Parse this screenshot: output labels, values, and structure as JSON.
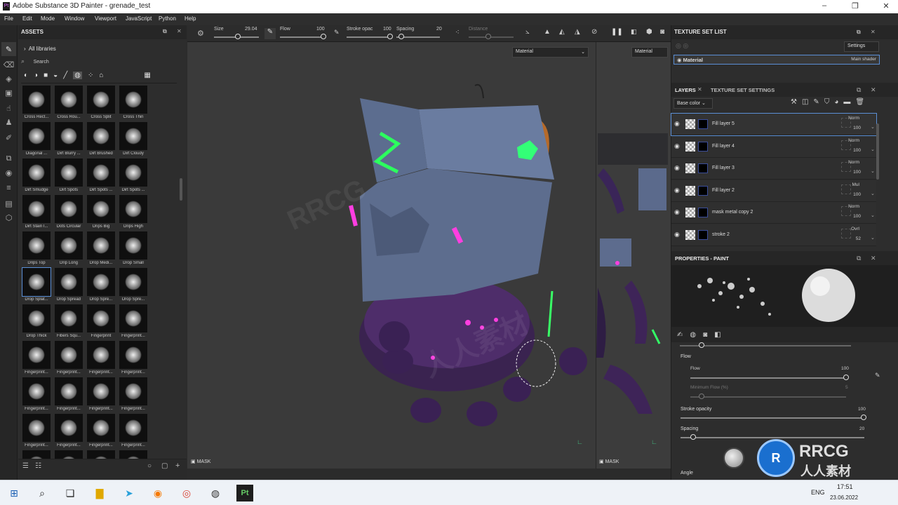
{
  "window": {
    "title": "Adobe Substance 3D Painter - grenade_test"
  },
  "menu": [
    "File",
    "Edit",
    "Mode",
    "Window",
    "Viewport",
    "JavaScript",
    "Python",
    "Help"
  ],
  "assets": {
    "title": "ASSETS",
    "breadcrumb": "All libraries",
    "search_placeholder": "Search",
    "items": [
      "Cross Rect...",
      "Cross Rou...",
      "Cross Split",
      "Cross Thin",
      "Diagonal ...",
      "Dirt Blurry ...",
      "Dirt Brushed",
      "Dirt Cloudy",
      "Dirt Smudge",
      "Dirt Spots",
      "Dirt Spots ...",
      "Dirt Spots ...",
      "Dirt Stain I...",
      "Dots Circular",
      "Drips Big",
      "Drips High",
      "Drips Top",
      "Drip Long",
      "Drop Medi...",
      "Drop Small",
      "Drop Splat...",
      "Drop Spread",
      "Drop Spre...",
      "Drop Spre...",
      "Drop Thick",
      "Fibers Squ...",
      "Fingerprint",
      "Fingerprint...",
      "Fingerprint...",
      "Fingerprint...",
      "Fingerprint...",
      "Fingerprint...",
      "Fingerprint...",
      "Fingerprint...",
      "Fingerprint...",
      "Fingerprint...",
      "Fingerprint...",
      "Fingerprint...",
      "Fingerprint...",
      "Fingerprint...",
      "",
      "",
      "",
      ""
    ],
    "selected_index": 20
  },
  "toolbar": {
    "size_label": "Size",
    "size_value": "29.04",
    "flow_label": "Flow",
    "flow_value": "100",
    "stroke_label": "Stroke opac",
    "stroke_value": "100",
    "spacing_label": "Spacing",
    "spacing_value": "20",
    "distance_label": "Distance"
  },
  "viewport": {
    "material_dropdown": "Material",
    "uv_material": "Material",
    "mask_label": "MASK",
    "uv_mask_label": "MASK"
  },
  "texture_set_list": {
    "title": "TEXTURE SET LIST",
    "settings": "Settings",
    "item": "Material",
    "shader": "Main shader"
  },
  "layers": {
    "tab1": "LAYERS",
    "tab2": "TEXTURE SET SETTINGS",
    "channel": "Base color",
    "rows": [
      {
        "name": "Fill layer 5",
        "blend": "Norm",
        "opacity": "100"
      },
      {
        "name": "Fill layer 4",
        "blend": "Norm",
        "opacity": "100"
      },
      {
        "name": "Fill layer 3",
        "blend": "Norm",
        "opacity": "100"
      },
      {
        "name": "Fill layer 2",
        "blend": "Mul",
        "opacity": "100"
      },
      {
        "name": "mask metal copy 2",
        "blend": "Norm",
        "opacity": "100"
      },
      {
        "name": "stroke 2",
        "blend": "Ovrl",
        "opacity": "52"
      }
    ]
  },
  "properties": {
    "title": "PROPERTIES - PAINT",
    "flow_section": "Flow",
    "flow_label": "Flow",
    "flow_value": "100",
    "min_flow_label": "Minimum Flow (%)",
    "min_flow_value": "5",
    "stroke_label": "Stroke opacity",
    "stroke_value": "100",
    "spacing_label": "Spacing",
    "spacing_value": "20",
    "angle_label": "Angle"
  },
  "taskbar": {
    "lang": "ENG",
    "time": "17:51",
    "date": "23.06.2022"
  },
  "watermarks": [
    "RRCG",
    "人人素材"
  ]
}
